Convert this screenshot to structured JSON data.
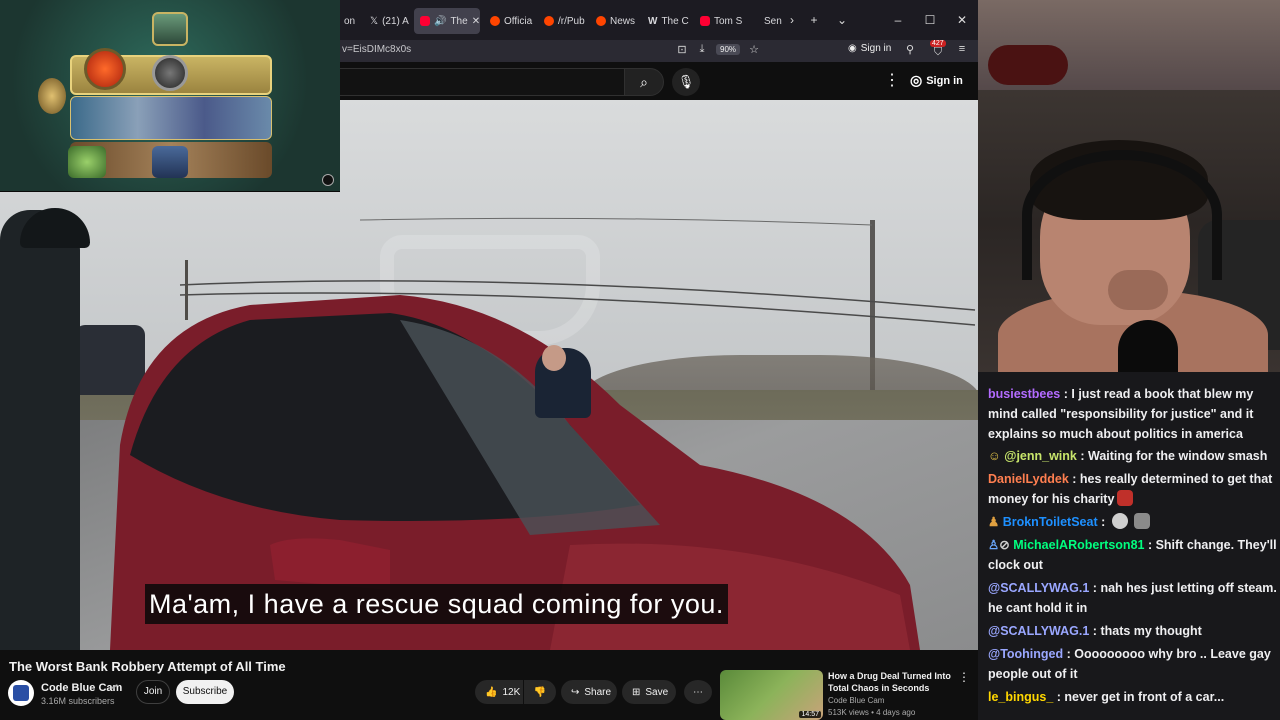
{
  "browser": {
    "tabs": [
      {
        "label": "on",
        "active": false,
        "color": "#888888"
      },
      {
        "label": "(21) A",
        "active": false,
        "color": "#000000"
      },
      {
        "label": "The",
        "active": true,
        "color": "#ff0033"
      },
      {
        "label": "Officia",
        "active": false,
        "color": "#ff4500"
      },
      {
        "label": "/r/Pub",
        "active": false,
        "color": "#ff4500"
      },
      {
        "label": "News",
        "active": false,
        "color": "#ff4500"
      },
      {
        "label": "The C",
        "active": false,
        "color": "#dddddd"
      },
      {
        "label": "Tom S",
        "active": false,
        "color": "#ff0033"
      },
      {
        "label": "Sen",
        "active": false,
        "color": "#888888"
      }
    ],
    "url": "v=EisDIMc8x0s",
    "zoom": "90%",
    "sign_in": "Sign in",
    "extension_badge": "427"
  },
  "youtube": {
    "sign_in": "Sign in",
    "video": {
      "subtitle": "Ma'am, I have a rescue squad coming for you.",
      "title": "The Worst Bank Robbery Attempt of All Time"
    },
    "channel": {
      "name": "Code Blue Cam",
      "subscribers": "3.16M subscribers",
      "join": "Join",
      "subscribe": "Subscribe"
    },
    "actions": {
      "likes": "12K",
      "share": "Share",
      "save": "Save"
    },
    "recommended": {
      "title": "How a Drug Deal Turned Into Total Chaos in Seconds",
      "channel": "Code Blue Cam",
      "meta": "513K views • 4 days ago",
      "duration": "14:57"
    }
  },
  "chat": {
    "messages": [
      {
        "user": "busiestbees",
        "color": "#b36bff",
        "text": "I just read a book that blew my mind called \"responsibility for justice\" and it explains so much about politics in america",
        "badges": []
      },
      {
        "user": "@jenn_wink",
        "color": "#c8e66b",
        "text": "Waiting for the window smash",
        "badges": [
          "smiley-badge"
        ]
      },
      {
        "user": "DanielLyddek",
        "color": "#ff7f50",
        "text": "hes really determined to get that money for his charity",
        "badges": [],
        "emote": "demon-emote"
      },
      {
        "user": "BroknToiletSeat",
        "color": "#1e90ff",
        "text": "",
        "badges": [
          "figure-badge"
        ],
        "emote": "skull-emote"
      },
      {
        "user": "MichaelARobertson81",
        "color": "#00ff7f",
        "text": "Shift change. They'll clock out",
        "badges": [
          "person-badge",
          "no-audio-badge"
        ]
      },
      {
        "user": "@SCALLYWAG.1",
        "color": "#9aa7ff",
        "text": "nah hes just letting off steam. he cant hold it in",
        "badges": []
      },
      {
        "user": "@SCALLYWAG.1",
        "color": "#9aa7ff",
        "text": "thats my thought",
        "badges": []
      },
      {
        "user": "@Toohinged",
        "color": "#9aa7ff",
        "text": "Ooooooooo why bro .. Leave gay people out of it",
        "badges": []
      },
      {
        "user": "le_bingus_",
        "color": "#ffd700",
        "text": "never get in front of a car...",
        "badges": []
      }
    ]
  }
}
